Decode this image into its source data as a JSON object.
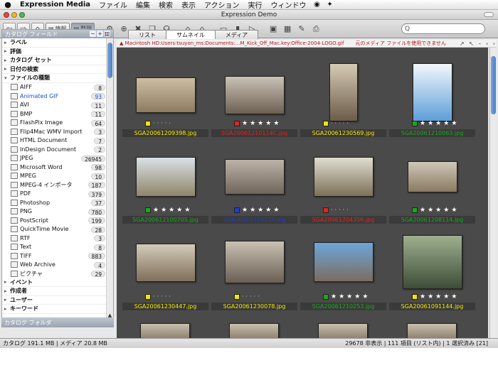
{
  "menubar": {
    "apple": "",
    "app": "Expression Media",
    "items": [
      "ファイル",
      "編集",
      "検索",
      "表示",
      "アクション",
      "実行",
      "ウィンドウ"
    ]
  },
  "window": {
    "title": "Expression Demo"
  },
  "toolbar": {
    "info_label": "情報",
    "organize_label": "整理",
    "search_placeholder": "Q"
  },
  "sidebar": {
    "header": "カタログ フィールド",
    "groups_top": [
      "ラベル",
      "評価",
      "カタログ セット",
      "日付の検索",
      "ファイルの種類"
    ],
    "file_types": [
      {
        "name": "AIFF",
        "count": "8",
        "icon": "audio-file-icon"
      },
      {
        "name": "Animated GIF",
        "count": "93",
        "icon": "gif-icon"
      },
      {
        "name": "AVI",
        "count": "11",
        "icon": "video-icon"
      },
      {
        "name": "BMP",
        "count": "11",
        "icon": "bmp-icon"
      },
      {
        "name": "FlashPix Image",
        "count": "64",
        "icon": "flashpix-icon"
      },
      {
        "name": "Flip4Mac WMV Import",
        "count": "3",
        "icon": "wmv-icon"
      },
      {
        "name": "HTML Document",
        "count": "7",
        "icon": "html-icon"
      },
      {
        "name": "InDesign Document",
        "count": "2",
        "icon": "indesign-icon"
      },
      {
        "name": "JPEG",
        "count": "26945",
        "icon": "jpeg-icon"
      },
      {
        "name": "Microsoft Word",
        "count": "98",
        "icon": "word-icon"
      },
      {
        "name": "MPEG",
        "count": "10",
        "icon": "mpeg-icon"
      },
      {
        "name": "MPEG-4 インポータ",
        "count": "187",
        "icon": "mpeg4-icon"
      },
      {
        "name": "PDF",
        "count": "379",
        "icon": "pdf-icon"
      },
      {
        "name": "Photoshop",
        "count": "37",
        "icon": "photoshop-icon"
      },
      {
        "name": "PNG",
        "count": "780",
        "icon": "png-icon"
      },
      {
        "name": "PostScript",
        "count": "199",
        "icon": "postscript-icon"
      },
      {
        "name": "QuickTime Movie",
        "count": "28",
        "icon": "quicktime-icon"
      },
      {
        "name": "RTF",
        "count": "3",
        "icon": "rtf-icon"
      },
      {
        "name": "Text",
        "count": "8",
        "icon": "text-icon"
      },
      {
        "name": "TIFF",
        "count": "883",
        "icon": "tiff-icon"
      },
      {
        "name": "Web Archive",
        "count": "4",
        "icon": "webarchive-icon"
      },
      {
        "name": "ピクチャ",
        "count": "29",
        "icon": "picture-icon"
      }
    ],
    "groups_bottom": [
      "イベント",
      "作成者",
      "ユーザー",
      "キーワード"
    ],
    "folder_header": "カタログ フォルダ"
  },
  "tabs": [
    "リスト",
    "サムネイル",
    "メディア"
  ],
  "active_tab": "サムネイル",
  "pathbar": {
    "path": "Macintosh HD:Users:tsuyon_ms:Documents:...M_Kick_Off_Mac.key:Office-2004-LOGO.gif",
    "message": "元のメディア ファイルを使用できません"
  },
  "thumbnails": [
    {
      "file": "SGA20061209398.jpg",
      "label_color": "#f2e600",
      "stars": 0,
      "name_color": "#f2e600"
    },
    {
      "file": "SGA20061210114C.jpg",
      "label_color": "#e0261b",
      "stars": 5,
      "name_color": "#e0261b"
    },
    {
      "file": "SGA20061230569.jpg",
      "label_color": "#f2e600",
      "stars": 0,
      "name_color": "#f2e600"
    },
    {
      "file": "SGA20061210063.jpg",
      "label_color": "#1aa81a",
      "stars": 5,
      "name_color": "#1aa81a"
    },
    {
      "file": "SGA20061210070S.jpg",
      "label_color": "#1aa81a",
      "stars": 5,
      "name_color": "#1aa81a"
    },
    {
      "file": "SGA20061210215.jpg",
      "label_color": "#1a3fd6",
      "stars": 5,
      "name_color": "#1a3fd6"
    },
    {
      "file": "SGA20061204356.jpg",
      "label_color": "#e0261b",
      "stars": 0,
      "name_color": "#e0261b"
    },
    {
      "file": "SGA20061208114.jpg",
      "label_color": "#1aa81a",
      "stars": 5,
      "name_color": "#1aa81a"
    },
    {
      "file": "SGA20061230447.jpg",
      "label_color": "#f2e600",
      "stars": 0,
      "name_color": "#f2e600"
    },
    {
      "file": "SGA20061230078.jpg",
      "label_color": "#f2e600",
      "stars": 0,
      "name_color": "#f2e600"
    },
    {
      "file": "SGA20061210253.jpg",
      "label_color": "#1aa81a",
      "stars": 5,
      "name_color": "#1aa81a"
    },
    {
      "file": "SGA20061091144.jpg",
      "label_color": "#f2e600",
      "stars": 5,
      "name_color": "#f2e600"
    }
  ],
  "status": {
    "left": "カタログ  191.1 MB  |  メディア  20.8 MB",
    "right": "29678 非表示  |  111 項目 (リスト内)  |  1 選択済み [21]"
  }
}
